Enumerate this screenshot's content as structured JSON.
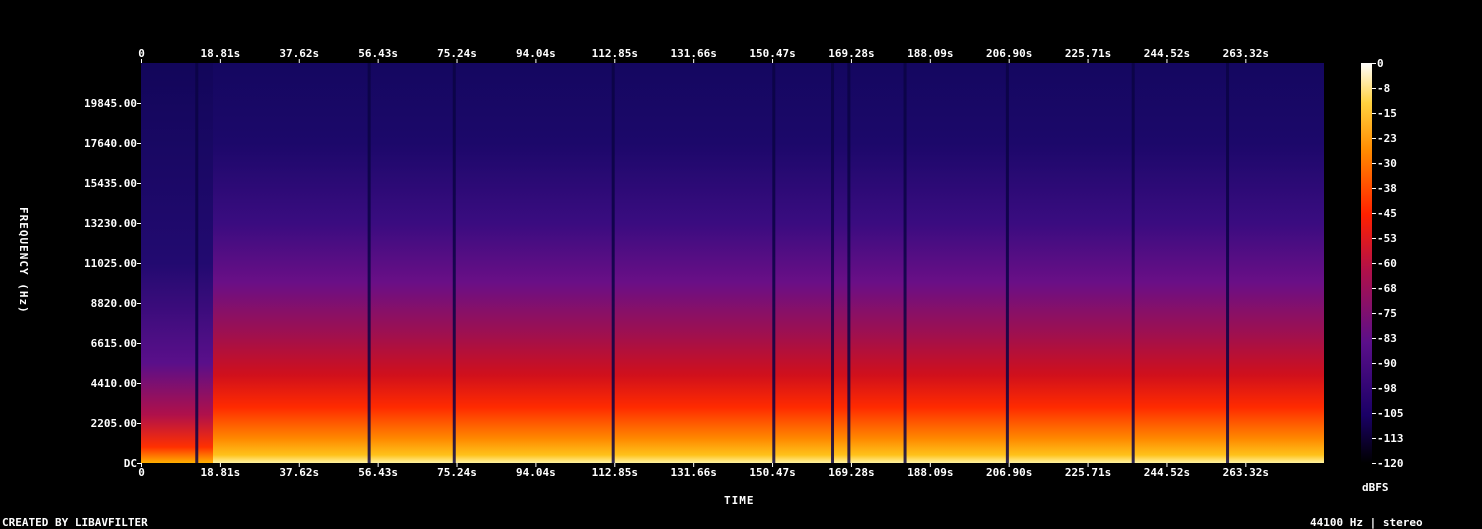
{
  "chart_data": {
    "type": "heatmap",
    "title": "",
    "xlabel": "TIME",
    "ylabel": "FREQUENCY (Hz)",
    "x_ticks": [
      "0",
      "18.81s",
      "37.62s",
      "56.43s",
      "75.24s",
      "94.04s",
      "112.85s",
      "131.66s",
      "150.47s",
      "169.28s",
      "188.09s",
      "206.90s",
      "225.71s",
      "244.52s",
      "263.32s"
    ],
    "y_ticks": [
      "DC",
      "2205.00",
      "4410.00",
      "6615.00",
      "8820.00",
      "11025.00",
      "13230.00",
      "15435.00",
      "17640.00",
      "19845.00"
    ],
    "y_values_hz": [
      0,
      2205,
      4410,
      6615,
      8820,
      11025,
      13230,
      15435,
      17640,
      19845
    ],
    "xlim_s": [
      0,
      282.1
    ],
    "ylim_hz": [
      0,
      22050
    ],
    "colorbar": {
      "unit": "dBFS",
      "ticks": [
        "0",
        "-8",
        "-15",
        "-23",
        "-30",
        "-38",
        "-45",
        "-53",
        "-60",
        "-68",
        "-75",
        "-83",
        "-90",
        "-98",
        "-105",
        "-113",
        "-120"
      ],
      "range_db": [
        0,
        -120
      ],
      "colors": [
        "#000000",
        "#1a0066",
        "#5a0f8a",
        "#b0104a",
        "#ff2000",
        "#ff8a00",
        "#ffd23f",
        "#ffffff"
      ]
    },
    "silence_dips_s": [
      13.3,
      54.4,
      74.7,
      112.6,
      150.9,
      164.9,
      168.8,
      182.2,
      206.6,
      236.6,
      259.1
    ],
    "energy_profile": [
      {
        "t": 0,
        "db_low": -55
      },
      {
        "t": 9,
        "db_low": -50
      },
      {
        "t": 14,
        "db_low": -48
      },
      {
        "t": 20,
        "db_low": -38
      },
      {
        "t": 50,
        "db_low": -34
      },
      {
        "t": 60,
        "db_low": -38
      },
      {
        "t": 100,
        "db_low": -32
      },
      {
        "t": 140,
        "db_low": -36
      },
      {
        "t": 200,
        "db_low": -33
      },
      {
        "t": 260,
        "db_low": -36
      },
      {
        "t": 278,
        "db_low": -42
      }
    ]
  },
  "footer": {
    "created_by": "CREATED BY LIBAVFILTER",
    "info": "44100 Hz | stereo"
  }
}
